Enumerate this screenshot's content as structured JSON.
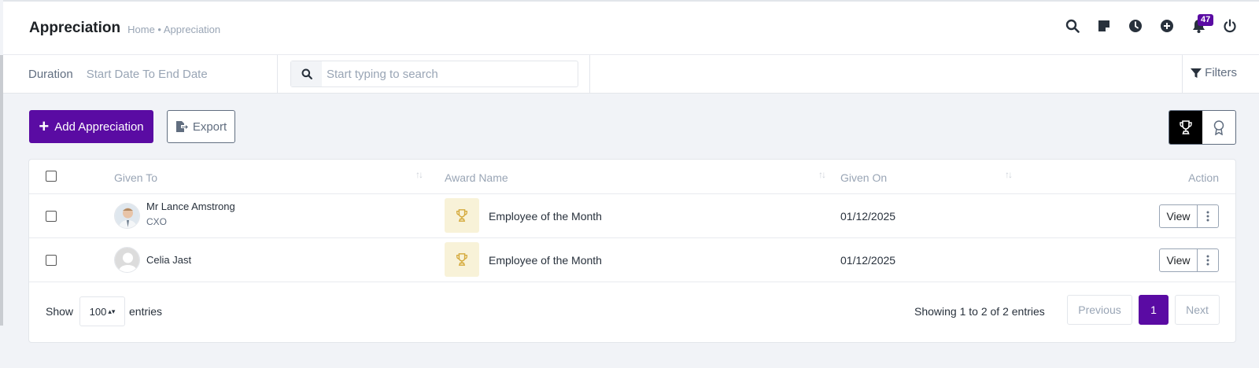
{
  "header": {
    "title": "Appreciation",
    "breadcrumb": "Home • Appreciation",
    "icons": [
      "search-icon",
      "sticky-note-icon",
      "clock-icon",
      "plus-circle-icon",
      "bell-icon",
      "power-icon"
    ],
    "notification_count": "47"
  },
  "filters": {
    "duration_label": "Duration",
    "duration_value": "Start Date To End Date",
    "search_placeholder": "Start typing to search",
    "filters_label": "Filters"
  },
  "actions": {
    "add_label": "Add Appreciation",
    "export_label": "Export"
  },
  "view_toggle": {
    "options": [
      "trophy-icon",
      "award-icon"
    ],
    "active": "trophy-icon"
  },
  "table": {
    "columns": [
      "Given To",
      "Award Name",
      "Given On",
      "Action"
    ],
    "rows": [
      {
        "name": "Mr Lance Amstrong",
        "role": "CXO",
        "award": "Employee of the Month",
        "date": "01/12/2025",
        "action": "View"
      },
      {
        "name": "Celia Jast",
        "role": "",
        "award": "Employee of the Month",
        "date": "01/12/2025",
        "action": "View"
      }
    ]
  },
  "footer": {
    "show_label": "Show",
    "page_length": "100",
    "entries_label": "entries",
    "info": "Showing 1 to 2 of 2 entries",
    "previous_label": "Previous",
    "current_page": "1",
    "next_label": "Next"
  },
  "colors": {
    "primary": "#5a0ba3",
    "award_bg": "#f8f2d8",
    "award_icon": "#d4a93a"
  }
}
